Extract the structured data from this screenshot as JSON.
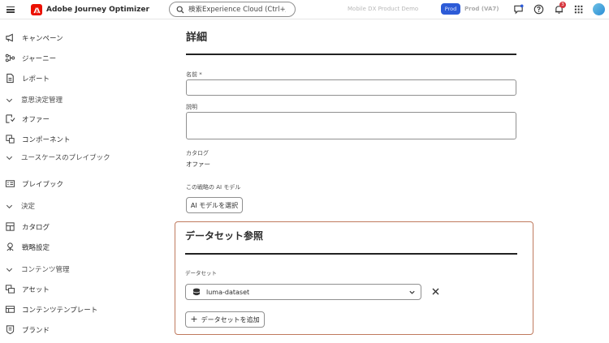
{
  "app": {
    "name": "Adobe Journey Optimizer"
  },
  "search": {
    "placeholder": "検索Experience Cloud (Ctrl+/)"
  },
  "header": {
    "sandbox": "Mobile DX Product Demo",
    "env_badge": "Prod",
    "env_name": "Prod (VA7)",
    "notification_count": "3"
  },
  "sidebar": {
    "items": [
      {
        "label": "キャンペーン",
        "icon": "campaign-icon"
      },
      {
        "label": "ジャーニー",
        "icon": "journey-icon"
      },
      {
        "label": "レポート",
        "icon": "report-icon"
      },
      {
        "label": "意思決定管理",
        "icon": "chevron-down-icon"
      },
      {
        "label": "オファー",
        "icon": "offer-icon"
      },
      {
        "label": "コンポーネント",
        "icon": "component-icon"
      },
      {
        "label": "ユースケースのプレイブック",
        "icon": "chevron-down-icon"
      },
      {
        "label": "プレイブック",
        "icon": "playbook-icon"
      },
      {
        "label": "決定",
        "icon": "chevron-down-icon"
      },
      {
        "label": "カタログ",
        "icon": "catalog-icon"
      },
      {
        "label": "戦略設定",
        "icon": "strategy-icon"
      },
      {
        "label": "コンテンツ管理",
        "icon": "chevron-down-icon"
      },
      {
        "label": "アセット",
        "icon": "asset-icon"
      },
      {
        "label": "コンテンツテンプレート",
        "icon": "template-icon"
      },
      {
        "label": "ブランド",
        "icon": "brand-icon"
      }
    ]
  },
  "details": {
    "title": "詳細",
    "name_label": "名前 *",
    "name_value": "",
    "description_label": "説明",
    "description_value": "",
    "category_label": "カタログ",
    "category_value": "オファー",
    "ai_model_label": "この戦略の AI モデル",
    "ai_model_button": "AI モデルを選択"
  },
  "dataset": {
    "title": "データセット参照",
    "field_label": "データセット",
    "selected": "luma-dataset",
    "add_button": "データセットを追加"
  },
  "colors": {
    "accent": "#2d5bd7",
    "brand": "#eb1000",
    "panel_border": "#bf7a5e"
  }
}
